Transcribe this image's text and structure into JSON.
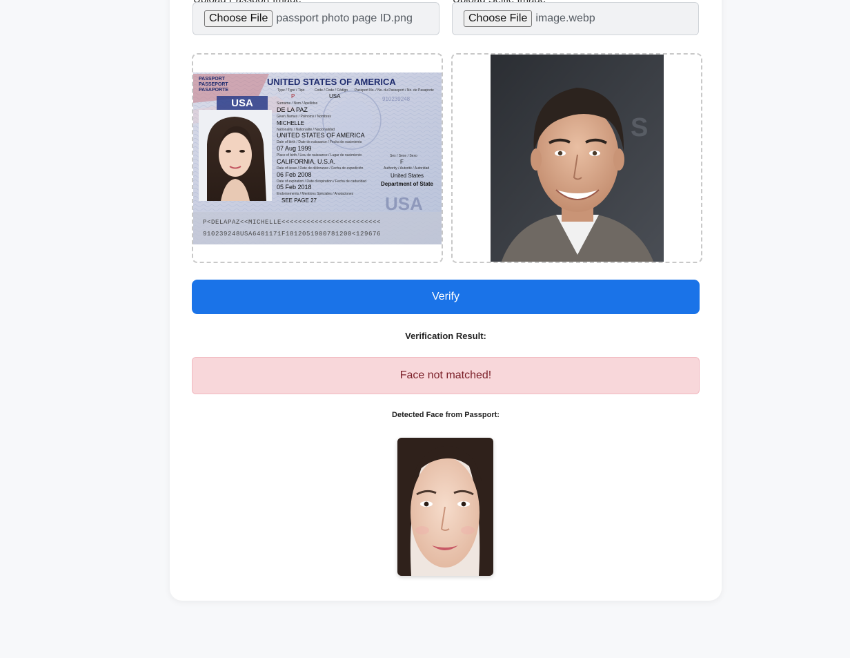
{
  "uploads": {
    "passport": {
      "button_label": "Choose File",
      "file_name": "passport photo page ID.png",
      "cut_label": "Upload Passport Image"
    },
    "selfie": {
      "button_label": "Choose File",
      "file_name": "image.webp",
      "cut_label": "Upload Selfie Image"
    }
  },
  "passport_doc": {
    "country": "UNITED STATES OF AMERICA",
    "passport_word_en": "PASSPORT",
    "passport_word_fr": "PASSEPORT",
    "passport_word_es": "PASAPORTE",
    "country_code_badge": "USA",
    "type_caption": "Type / Type / Tipo",
    "code_caption": "Code / Code / Código",
    "number_caption": "Passport No. / No. du Passeport / No. de Pasaporte",
    "type": "P",
    "code": "USA",
    "number": "910239248",
    "surname_caption": "Surname / Nom / Apellidos",
    "surname": "DE LA PAZ",
    "given_caption": "Given Names / Prénoms / Nombres",
    "given": "MICHELLE",
    "nationality_caption": "Nationality / Nationalité / Nacionalidad",
    "nationality": "UNITED STATES OF AMERICA",
    "dob_caption": "Date of birth / Date de naissance / Fecha de nacimiento",
    "dob": "07 Aug 1999",
    "pob_caption": "Place of birth / Lieu de naissance / Lugar de nacimiento",
    "pob": "CALIFORNIA, U.S.A.",
    "sex_caption": "Sex / Sexe / Sexo",
    "sex": "F",
    "issue_caption": "Date of issue / Date de délivrance / Fecha de expedición",
    "issue": "06 Feb 2008",
    "authority_caption": "Authority / Autorité / Autoridad",
    "authority_line1": "United States",
    "authority_line2": "Department of State",
    "expiry_caption": "Date of expiration / Date d'expiration / Fecha de caducidad",
    "expiry": "05 Feb 2018",
    "endorse_caption": "Endorsements / Mentions Spéciales / Anotaciones",
    "endorse": "SEE PAGE 27",
    "usa_watermark": "USA",
    "mrz1": "P<DELAPAZ<<MICHELLE<<<<<<<<<<<<<<<<<<<<<<<<",
    "mrz2": "910239248USA6401171F1812051900781200<129676"
  },
  "actions": {
    "verify_label": "Verify"
  },
  "result": {
    "title": "Verification Result:",
    "message": "Face not matched!",
    "status_color": "#f8d7da",
    "detected_title": "Detected Face from Passport:"
  },
  "colors": {
    "accent": "#1a73e8",
    "error_bg": "#f8d7da",
    "error_text": "#7a1e27"
  }
}
